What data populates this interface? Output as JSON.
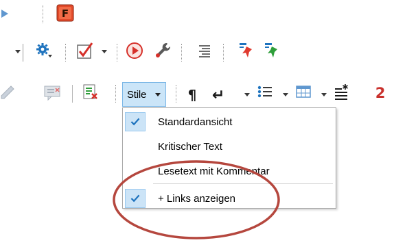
{
  "toolbar": {
    "app_badge_letter": "F",
    "pilcrow_glyph": "¶",
    "return_glyph": "↵",
    "note_glyph": "2",
    "styles_button": {
      "label": "Stile"
    }
  },
  "styles_menu": {
    "items": [
      {
        "label": "Standardansicht",
        "checked": true
      },
      {
        "label": "Kritischer Text",
        "checked": false
      },
      {
        "label": "Lesetext mit Kommentar",
        "checked": false
      },
      {
        "label": "+ Links anzeigen",
        "checked": true
      }
    ]
  },
  "colors": {
    "accent_blue": "#1e73be",
    "menu_highlight": "#cce4f7",
    "annotation_ring": "#b5473e",
    "app_badge": "#e24a2a"
  }
}
